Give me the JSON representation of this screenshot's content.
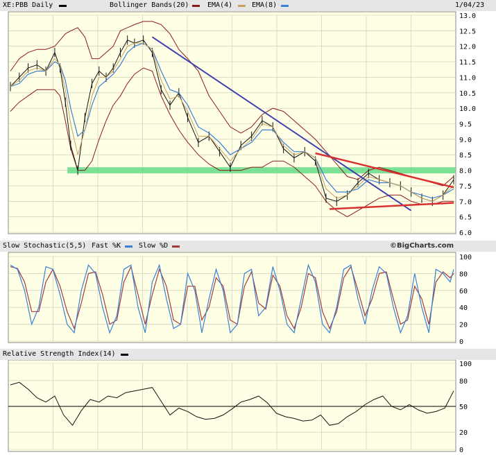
{
  "chart_data": [
    {
      "type": "line",
      "title": "XE:PBB Daily",
      "date": "1/04/23",
      "legend": [
        {
          "name": "Bollinger Bands(20)",
          "color": "#8b1a1a"
        },
        {
          "name": "EMA(4)",
          "color": "#c8a060"
        },
        {
          "name": "EMA(8)",
          "color": "#3a7fd5"
        }
      ],
      "ylim": [
        6.0,
        13.0
      ],
      "y_ticks": [
        "13.0",
        "12.5",
        "12.0",
        "11.5",
        "11.0",
        "10.5",
        "10.0",
        "9.5",
        "9.0",
        "8.5",
        "8.0",
        "7.5",
        "7.0",
        "6.5",
        "6.0"
      ],
      "x": [
        0,
        5,
        10,
        15,
        20,
        25,
        28,
        31,
        34,
        38,
        42,
        46,
        50,
        54,
        58,
        62,
        66,
        70,
        75,
        80,
        85,
        90,
        95,
        100,
        106,
        112,
        118,
        124,
        130,
        136,
        142,
        148,
        154,
        160,
        166,
        172,
        178,
        184,
        190,
        196,
        202,
        208,
        214,
        220,
        226,
        232,
        238,
        244,
        250
      ],
      "price": [
        10.7,
        11.0,
        11.3,
        11.4,
        11.2,
        11.8,
        11.3,
        10.2,
        8.8,
        8.0,
        9.7,
        10.8,
        11.2,
        11.0,
        11.3,
        11.8,
        12.2,
        12.1,
        12.2,
        11.8,
        10.6,
        10.1,
        10.5,
        9.7,
        8.9,
        9.1,
        8.6,
        8.1,
        8.8,
        9.1,
        9.6,
        9.4,
        8.7,
        8.4,
        8.6,
        8.3,
        7.1,
        7.0,
        7.2,
        7.6,
        7.9,
        7.7,
        7.6,
        7.5,
        7.3,
        7.1,
        7.0,
        7.2,
        7.7
      ],
      "ema4": [
        10.7,
        10.9,
        11.2,
        11.3,
        11.2,
        11.6,
        11.4,
        10.6,
        9.5,
        8.5,
        9.3,
        10.4,
        11.0,
        11.0,
        11.2,
        11.6,
        12.0,
        12.1,
        12.1,
        11.9,
        10.9,
        10.3,
        10.4,
        9.9,
        9.1,
        9.1,
        8.7,
        8.3,
        8.7,
        9.0,
        9.5,
        9.4,
        8.8,
        8.5,
        8.6,
        8.4,
        7.4,
        7.1,
        7.2,
        7.5,
        7.8,
        7.7,
        7.6,
        7.5,
        7.3,
        7.1,
        7.0,
        7.2,
        7.5
      ],
      "ema8": [
        10.7,
        10.8,
        11.1,
        11.2,
        11.2,
        11.5,
        11.4,
        10.9,
        10.0,
        9.1,
        9.3,
        10.1,
        10.7,
        10.9,
        11.1,
        11.4,
        11.8,
        12.0,
        12.1,
        11.9,
        11.2,
        10.6,
        10.5,
        10.1,
        9.4,
        9.2,
        8.9,
        8.5,
        8.7,
        8.9,
        9.3,
        9.3,
        8.9,
        8.6,
        8.6,
        8.4,
        7.7,
        7.3,
        7.3,
        7.4,
        7.7,
        7.6,
        7.6,
        7.5,
        7.3,
        7.2,
        7.1,
        7.2,
        7.4
      ],
      "bb_upper": [
        11.2,
        11.6,
        11.8,
        11.9,
        11.9,
        12.0,
        12.2,
        12.4,
        12.5,
        12.6,
        12.3,
        11.6,
        11.6,
        11.8,
        12.0,
        12.5,
        12.6,
        12.7,
        12.8,
        12.8,
        12.7,
        12.4,
        11.9,
        11.6,
        11.2,
        10.4,
        9.9,
        9.4,
        9.2,
        9.4,
        9.8,
        10.0,
        9.9,
        9.6,
        9.3,
        9.0,
        8.6,
        8.2,
        7.8,
        7.7,
        8.0,
        8.1,
        8.0,
        7.9,
        7.8,
        7.7,
        7.6,
        7.5,
        7.8
      ],
      "bb_lower": [
        9.9,
        10.2,
        10.4,
        10.6,
        10.6,
        10.6,
        10.4,
        9.6,
        8.7,
        8.0,
        8.0,
        8.3,
        9.0,
        9.6,
        10.1,
        10.4,
        10.8,
        11.1,
        11.3,
        11.2,
        10.4,
        9.8,
        9.3,
        8.9,
        8.5,
        8.2,
        8.0,
        8.0,
        8.0,
        8.1,
        8.1,
        8.3,
        8.3,
        8.1,
        7.8,
        7.5,
        7.0,
        6.7,
        6.5,
        6.7,
        6.9,
        7.1,
        7.2,
        7.2,
        7.0,
        6.9,
        6.9,
        7.0,
        7.0
      ],
      "trendlines": [
        {
          "color": "#4040b0",
          "from": [
            80,
            12.3
          ],
          "to": [
            226,
            6.7
          ]
        },
        {
          "color": "#d83030",
          "from": [
            172,
            8.55
          ],
          "to": [
            250,
            7.45
          ]
        },
        {
          "color": "#d83030",
          "from": [
            180,
            6.75
          ],
          "to": [
            250,
            6.95
          ]
        }
      ],
      "support_band": {
        "color": "#66dd88",
        "from": 7.9,
        "to": 8.1
      }
    },
    {
      "type": "line",
      "title": "Slow Stochastic(5,5)",
      "credit": "©BigCharts.com",
      "legend": [
        {
          "name": "Fast %K",
          "color": "#3a7fd5"
        },
        {
          "name": "Slow %D",
          "color": "#a33a3a"
        }
      ],
      "ylim": [
        0,
        100
      ],
      "y_ticks": [
        "100",
        "80",
        "60",
        "40",
        "20",
        "0"
      ],
      "x": [
        0,
        4,
        8,
        12,
        16,
        20,
        24,
        28,
        32,
        36,
        40,
        44,
        48,
        52,
        56,
        60,
        64,
        68,
        72,
        76,
        80,
        84,
        88,
        92,
        96,
        100,
        104,
        108,
        112,
        116,
        120,
        124,
        128,
        132,
        136,
        140,
        144,
        148,
        152,
        156,
        160,
        164,
        168,
        172,
        176,
        180,
        184,
        188,
        192,
        196,
        200,
        204,
        208,
        212,
        216,
        220,
        224,
        228,
        232,
        236,
        240,
        244,
        248,
        250
      ],
      "fast_k": [
        90,
        85,
        60,
        20,
        40,
        88,
        85,
        55,
        20,
        10,
        60,
        90,
        80,
        40,
        10,
        30,
        85,
        90,
        40,
        10,
        70,
        90,
        50,
        15,
        20,
        80,
        60,
        10,
        50,
        85,
        60,
        10,
        20,
        80,
        85,
        30,
        40,
        88,
        60,
        20,
        10,
        50,
        90,
        70,
        20,
        10,
        40,
        85,
        90,
        50,
        20,
        60,
        88,
        80,
        40,
        10,
        30,
        80,
        40,
        10,
        85,
        80,
        70,
        85
      ],
      "slow_d": [
        88,
        86,
        70,
        35,
        35,
        70,
        85,
        65,
        35,
        15,
        45,
        80,
        82,
        55,
        20,
        25,
        70,
        88,
        55,
        20,
        55,
        85,
        65,
        25,
        20,
        65,
        65,
        25,
        40,
        75,
        65,
        25,
        20,
        65,
        82,
        45,
        38,
        78,
        65,
        30,
        15,
        40,
        80,
        75,
        35,
        15,
        35,
        75,
        88,
        60,
        30,
        50,
        80,
        82,
        50,
        20,
        25,
        65,
        50,
        20,
        70,
        82,
        75,
        80
      ]
    },
    {
      "type": "line",
      "title": "Relative Strength Index(14)",
      "legend": [
        {
          "name": "Relative Strength Index(14)",
          "color": "#111111"
        }
      ],
      "ylim": [
        0,
        100
      ],
      "y_ticks": [
        "100",
        "80",
        "50",
        "20",
        "0"
      ],
      "reference_line": 50,
      "x": [
        0,
        5,
        10,
        15,
        20,
        25,
        30,
        35,
        40,
        45,
        50,
        55,
        60,
        65,
        70,
        75,
        80,
        85,
        90,
        95,
        100,
        105,
        110,
        115,
        120,
        125,
        130,
        135,
        140,
        145,
        150,
        155,
        160,
        165,
        170,
        175,
        180,
        185,
        190,
        195,
        200,
        205,
        210,
        215,
        220,
        225,
        230,
        235,
        240,
        245,
        250
      ],
      "values": [
        75,
        78,
        70,
        60,
        55,
        62,
        40,
        28,
        45,
        58,
        55,
        62,
        60,
        66,
        68,
        70,
        72,
        56,
        40,
        48,
        44,
        38,
        35,
        36,
        40,
        47,
        55,
        58,
        62,
        54,
        42,
        38,
        36,
        33,
        34,
        40,
        28,
        30,
        38,
        44,
        52,
        58,
        62,
        50,
        46,
        52,
        46,
        42,
        44,
        48,
        68
      ]
    }
  ]
}
